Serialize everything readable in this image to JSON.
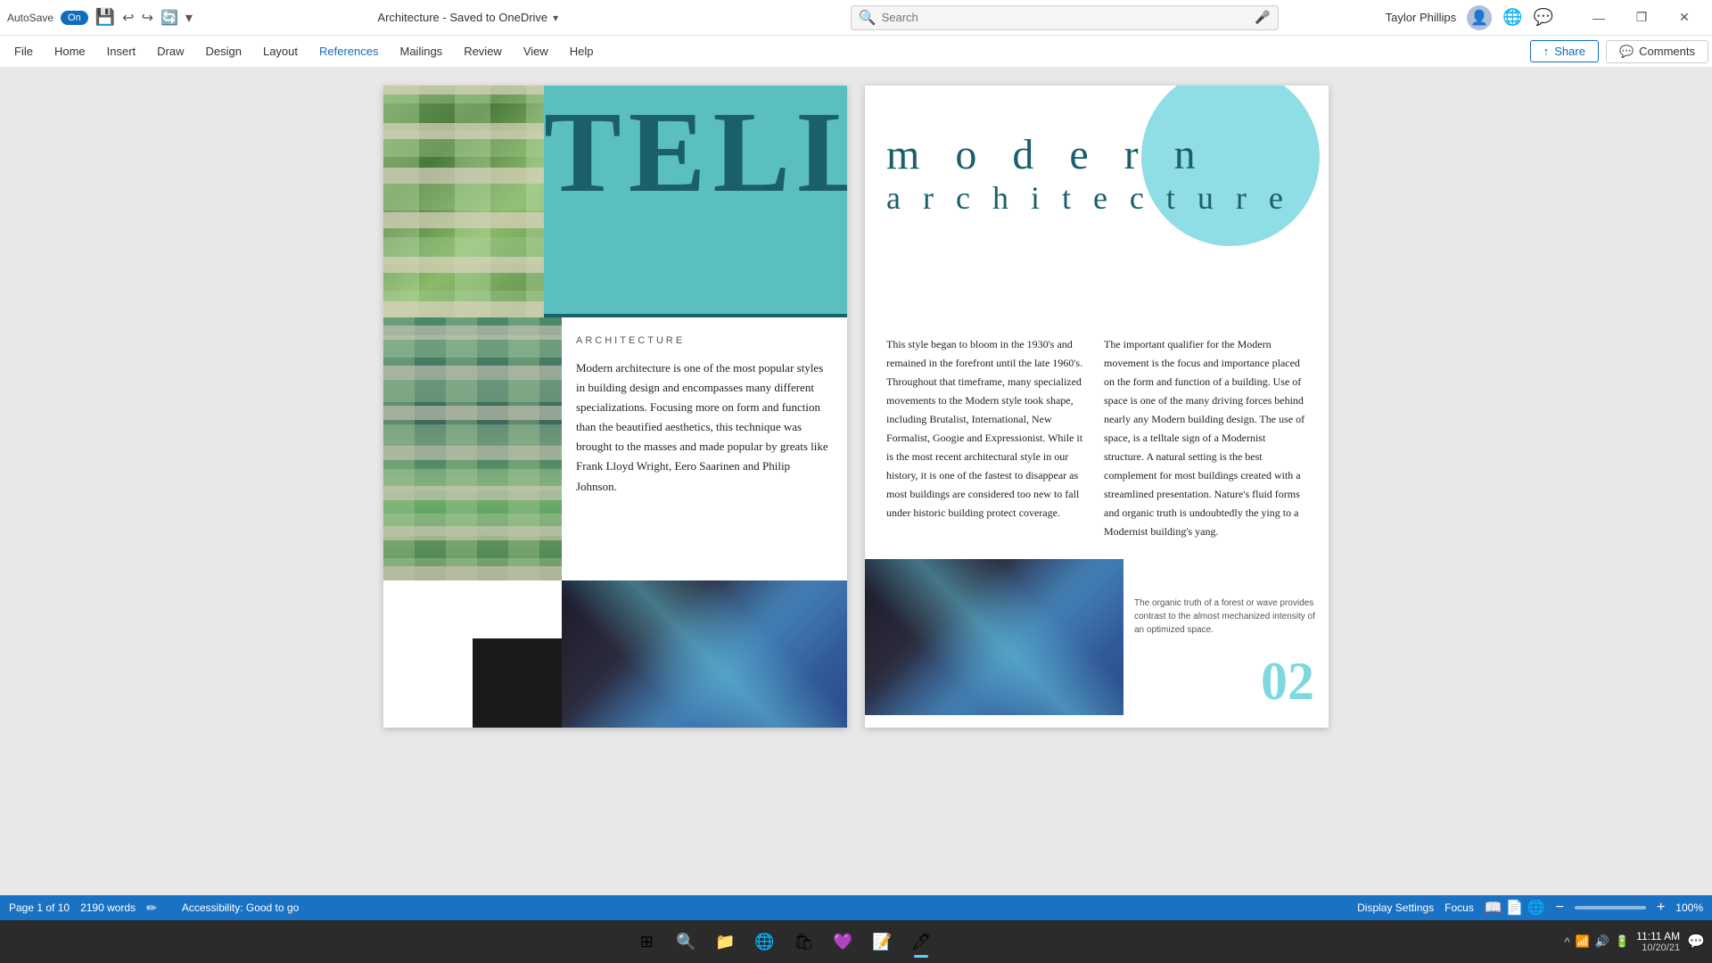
{
  "titlebar": {
    "autosave_label": "AutoSave",
    "autosave_state": "On",
    "doc_title": "Architecture - Saved to OneDrive",
    "search_placeholder": "Search",
    "user_name": "Taylor Phillips",
    "win_minimize": "—",
    "win_restore": "❐",
    "win_close": "✕"
  },
  "menubar": {
    "items": [
      "File",
      "Home",
      "Insert",
      "Draw",
      "Design",
      "Layout",
      "References",
      "Mailings",
      "Review",
      "View",
      "Help"
    ],
    "share_label": "Share",
    "comments_label": "Comments"
  },
  "page_left": {
    "tell_text": "TELL",
    "arch_label": "ARCHITECTURE",
    "arch_body": "Modern architecture is one of the most popular styles in building design and encompasses many different specializations. Focusing more on form and function than the beautified aesthetics, this technique was brought to the masses and made popular by greats like Frank Lloyd Wright, Eero Saarinen and Philip Johnson."
  },
  "page_right": {
    "modern_line1": "m o d e r n",
    "modern_line2": "a r c h i t e c t u r e",
    "col1_text": "This style began to bloom in the 1930's and remained in the forefront until the late 1960's. Throughout that timeframe, many specialized movements to the Modern style took shape, including Brutalist, International, New Formalist, Googie and Expressionist. While it is the most recent architectural style in our history, it is one of the fastest to disappear as most buildings are considered too new to fall under historic building protect coverage.",
    "col2_text": "The important qualifier for the Modern movement is the focus and importance placed on the form and function of a building. Use of space is one of the many driving forces behind nearly any Modern building design. The use of space, is a telltale sign of a Modernist structure. A natural setting is the best complement for most buildings created with a streamlined presentation. Nature's fluid forms and organic truth is undoubtedly the ying to a Modernist building's yang.",
    "caption": "The organic truth of a forest or wave provides contrast to the almost mechanized intensity of an optimized space.",
    "page_num": "02"
  },
  "statusbar": {
    "page_info": "Page 1 of 10",
    "word_count": "2190 words",
    "accessibility": "Accessibility: Good to go",
    "display_settings": "Display Settings",
    "focus": "Focus",
    "zoom": "100%"
  },
  "taskbar": {
    "items": [
      "⊞",
      "🔍",
      "📁",
      "📋",
      "💬",
      "🗺",
      "🦊",
      "🖊"
    ],
    "time": "11:11 AM",
    "date": "10/20/21"
  }
}
